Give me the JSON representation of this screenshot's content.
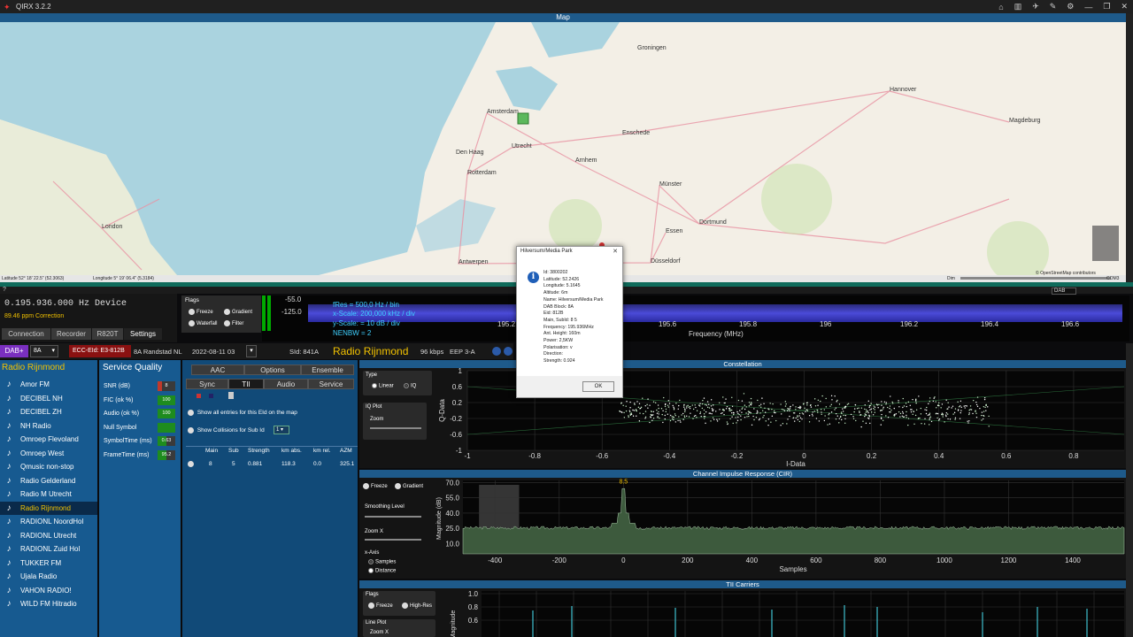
{
  "window": {
    "title": "QIRX 3.2.2"
  },
  "map": {
    "title": "Map",
    "cities": [
      {
        "n": "London",
        "x": 115,
        "y": 233
      },
      {
        "n": "Amsterdam",
        "x": 550,
        "y": 103
      },
      {
        "n": "Den Haag",
        "x": 515,
        "y": 149
      },
      {
        "n": "Rotterdam",
        "x": 528,
        "y": 172
      },
      {
        "n": "Antwerpen",
        "x": 518,
        "y": 273
      },
      {
        "n": "Utrecht",
        "x": 578,
        "y": 142
      },
      {
        "n": "Arnhem",
        "x": 650,
        "y": 158
      },
      {
        "n": "Dortmund",
        "x": 790,
        "y": 228
      },
      {
        "n": "Essen",
        "x": 752,
        "y": 238
      },
      {
        "n": "Düsseldorf",
        "x": 735,
        "y": 272
      },
      {
        "n": "Hannover",
        "x": 1005,
        "y": 78
      },
      {
        "n": "Magdeburg",
        "x": 1140,
        "y": 113
      },
      {
        "n": "Enschede",
        "x": 703,
        "y": 127
      },
      {
        "n": "Münster",
        "x": 745,
        "y": 185
      },
      {
        "n": "Groningen",
        "x": 720,
        "y": 31
      }
    ],
    "status_left": "Latitude 52° 18' 22.5\" (52.3063)",
    "status_mid": "Longitude 5° 19' 06.4\" (5.3184)",
    "status_dim": "Dim",
    "status_com": "COM3",
    "attribution": "© OpenStreetMap contributors"
  },
  "device": {
    "freq": "0.195.936.000 Hz Device",
    "correction": "89.46 ppm Correction",
    "tabs": [
      "Connection",
      "Recorder",
      "R820T",
      "Settings"
    ],
    "flags_title": "Flags",
    "flags": [
      "Freeze",
      "Gradient",
      "Waterfall",
      "Filter"
    ]
  },
  "spectrum": {
    "db_top": "-55.0",
    "db_bot": "-125.0",
    "fres": "fRes = 500,0 Hz / bin",
    "xscale": "x-Scale: 200,000 kHz / div",
    "yscale": "y-Scale: = 10 dB / div",
    "nenbw": "NENBW = 2",
    "xticks": [
      "195.2",
      "195.4",
      "195.6",
      "195.8",
      "196",
      "196.2",
      "196.4",
      "196.6",
      "196.8"
    ],
    "xlabel": "Frequency (MHz)",
    "dab_sel": "DAB"
  },
  "infobar": {
    "dab": "DAB+",
    "channel": "8A",
    "ecc": "ECC-EId: E3-812B",
    "ensemble": "8A Randstad NL",
    "date": "2022-08-11 03",
    "sid": "SId: 841A",
    "service": "Radio Rijnmond",
    "bitrate": "96 kbps",
    "eep": "EEP 3-A"
  },
  "channels": {
    "header": "Radio Rijnmond",
    "items": [
      "Amor FM",
      "DECIBEL NH",
      "DECIBEL ZH",
      "NH Radio",
      "Omroep Flevoland",
      "Omroep West",
      "Qmusic non-stop",
      "Radio Gelderland",
      "Radio M Utrecht",
      "Radio Rijnmond",
      "RADIONL NoordHol",
      "RADIONL Utrecht",
      "RADIONL Zuid Hol",
      "TUKKER FM",
      "Ujala Radio",
      "VAHON RADIO!",
      "WILD FM Hitradio"
    ],
    "selected_index": 9
  },
  "service_quality": {
    "title": "Service Quality",
    "rows": [
      {
        "label": "SNR (dB)",
        "value": "8",
        "color": "#c0392b",
        "fill": 0.25
      },
      {
        "label": "FIC (ok %)",
        "value": "100",
        "color": "#1e8c1e",
        "fill": 1
      },
      {
        "label": "Audio (ok %)",
        "value": "100",
        "color": "#1e8c1e",
        "fill": 1
      },
      {
        "label": "Null Symbol",
        "value": "",
        "color": "#1e8c1e",
        "fill": 1
      },
      {
        "label": "SymbolTime (ms)",
        "value": "0.63",
        "color": "#1e8c1e",
        "fill": 0.5
      },
      {
        "label": "FrameTime (ms)",
        "value": "95.2",
        "color": "#1e8c1e",
        "fill": 0.5
      }
    ]
  },
  "tii_panel": {
    "tabs_row1": [
      "AAC",
      "Options",
      "Ensemble"
    ],
    "tabs_row2": [
      "Sync",
      "TII",
      "Audio",
      "Service"
    ],
    "opt1": "Show all entries for this EId on the map",
    "opt2": "Show Collisions for Sub Id",
    "sub_id": "1",
    "headers": [
      "Main",
      "Sub",
      "Strength",
      "km abs.",
      "km rel.",
      "AZM"
    ],
    "row": [
      "8",
      "5",
      "0.881",
      "118.3",
      "0.0",
      "325.1"
    ]
  },
  "constellation": {
    "title": "Constellation",
    "type_label": "Type",
    "type_opts": [
      "Linear",
      "IQ"
    ],
    "iq_plot": "IQ Plot",
    "zoom": "Zoom",
    "yticks": [
      "1",
      "0.6",
      "0.2",
      "-0.2",
      "-0.6",
      "-1"
    ],
    "xticks": [
      "-1",
      "-0.8",
      "-0.6",
      "-0.4",
      "-0.2",
      "0",
      "0.2",
      "0.4",
      "0.6",
      "0.8"
    ],
    "xlabel": "I-Data",
    "ylabel": "Q-Data"
  },
  "cir": {
    "title": "Channel Impulse Response (CIR)",
    "freeze": "Freeze",
    "gradient": "Gradient",
    "smoothing": "Smoothing Level",
    "zoom": "Zoom X",
    "xaxis": "x-Axis",
    "opts": [
      "Samples",
      "Distance"
    ],
    "yticks": [
      "70.0",
      "55.0",
      "40.0",
      "25.0",
      "10.0"
    ],
    "xticks": [
      "-400",
      "-200",
      "0",
      "200",
      "400",
      "600",
      "800",
      "1000",
      "1200",
      "1400"
    ],
    "xlabel": "Samples",
    "ylabel": "Magnitude (dB)",
    "peak": "8.5"
  },
  "tii": {
    "title": "TII Carriers",
    "flags": "Flags",
    "freeze": "Freeze",
    "highres": "High-Res",
    "lineplot": "Line Plot",
    "zoom": "Zoom X",
    "yticks": [
      "1.0",
      "0.8",
      "0.6"
    ],
    "ylabel": "Magnitude"
  },
  "dialog": {
    "title": "Hilversum/Media Park",
    "close": "✕",
    "ok": "OK",
    "lines": [
      "Id: 3800202",
      "Latitude: 52.2426",
      "Longitude: 5.1645",
      "Altitude: 6m",
      "Name: Hilversum/Media Park",
      "DAB Block: 8A",
      "Eid: 812B",
      "Main, SubId: 8 5",
      "Frequency: 195.936MHz",
      "Ant. Height: 160m",
      "Power: 2,5KW",
      "Polarisation: v",
      "Direction:",
      "Strength: 0.924"
    ]
  }
}
